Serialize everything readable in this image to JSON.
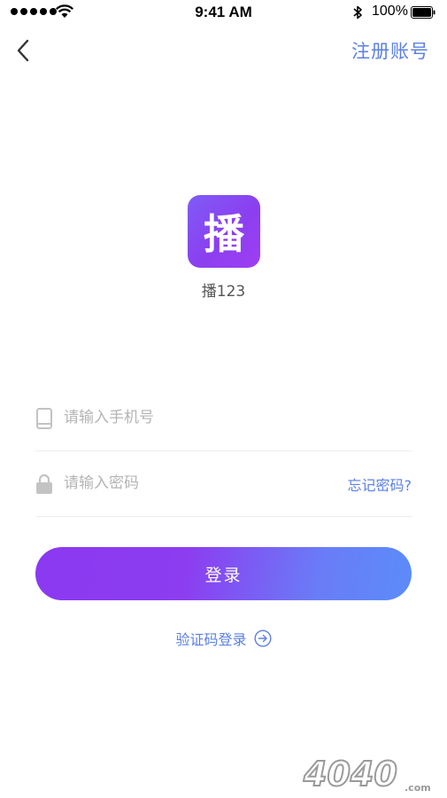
{
  "status_bar": {
    "time": "9:41 AM",
    "battery": "100%"
  },
  "nav": {
    "back_icon": "chevron-left-icon",
    "register_label": "注册账号"
  },
  "app": {
    "logo_char": "播",
    "name": "播123"
  },
  "form": {
    "phone_placeholder": "请输入手机号",
    "phone_value": "",
    "password_placeholder": "请输入密码",
    "password_value": "",
    "forgot_label": "忘记密码?"
  },
  "login_label": "登录",
  "sms_login_label": "验证码登录",
  "watermark": "4040",
  "watermark_suffix": ".com",
  "colors": {
    "accent_blue": "#5b7fe6",
    "gradient_start": "#8b39f1",
    "gradient_end": "#5b8cf8",
    "logo": "#8b3ff0"
  }
}
